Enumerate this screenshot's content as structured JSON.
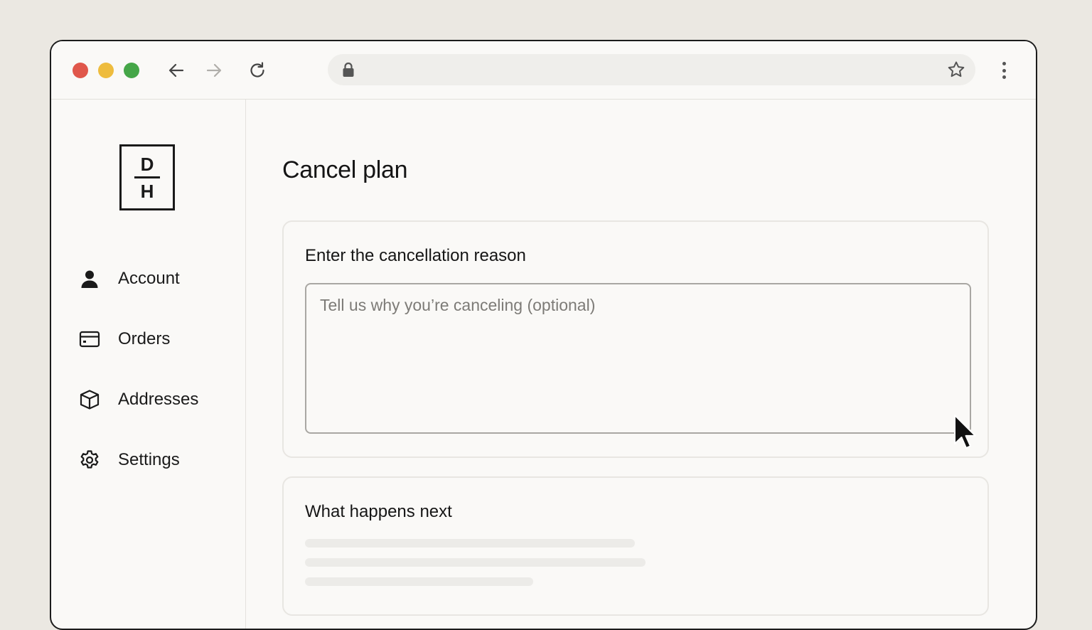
{
  "colors": {
    "traffic_red": "#e0574b",
    "traffic_yellow": "#eebc3e",
    "traffic_green": "#45a648",
    "window_bg": "#faf9f7",
    "desktop_bg": "#ebe8e2"
  },
  "browser": {
    "url": "",
    "icons": [
      "back-arrow-icon",
      "forward-arrow-icon",
      "reload-icon",
      "lock-icon",
      "star-icon",
      "more-vertical-icon"
    ]
  },
  "logo": {
    "top": "D",
    "bottom": "H"
  },
  "sidebar": {
    "items": [
      {
        "label": "Account",
        "icon": "user-icon"
      },
      {
        "label": "Orders",
        "icon": "card-icon"
      },
      {
        "label": "Addresses",
        "icon": "box-icon"
      },
      {
        "label": "Settings",
        "icon": "gear-icon"
      }
    ]
  },
  "main": {
    "title": "Cancel plan",
    "reason_card": {
      "title": "Enter the cancellation reason",
      "placeholder": "Tell us why you’re canceling (optional)",
      "value": ""
    },
    "next_card": {
      "title": "What happens next"
    }
  }
}
